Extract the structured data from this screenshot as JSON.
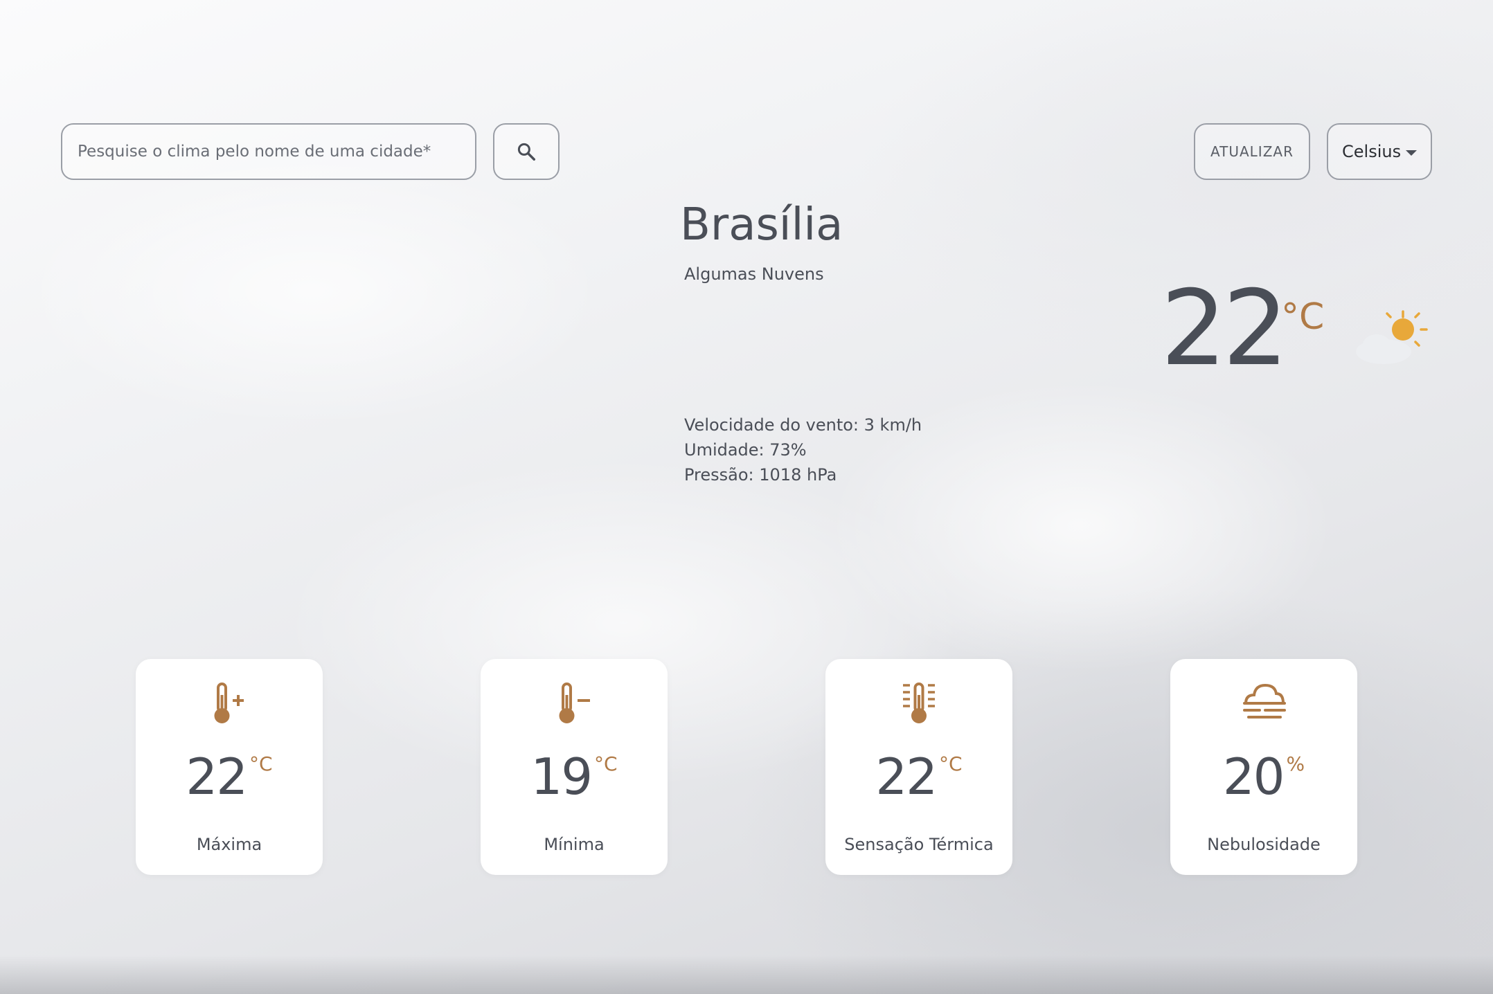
{
  "search": {
    "placeholder": "Pesquise o clima pelo nome de uma cidade*"
  },
  "toolbar": {
    "refresh_label": "ATUALIZAR",
    "unit_selected": "Celsius"
  },
  "current": {
    "city": "Brasília",
    "condition": "Algumas Nuvens",
    "temperature": "22",
    "unit": "°C",
    "icon": "sun-behind-cloud-icon"
  },
  "details": {
    "wind": "Velocidade do vento: 3 km/h",
    "humidity": "Umidade: 73%",
    "pressure": "Pressão: 1018 hPa"
  },
  "cards": [
    {
      "icon": "thermometer-plus-icon",
      "value": "22",
      "unit": "°C",
      "label": "Máxima"
    },
    {
      "icon": "thermometer-minus-icon",
      "value": "19",
      "unit": "°C",
      "label": "Mínima"
    },
    {
      "icon": "thermometer-feels-like-icon",
      "value": "22",
      "unit": "°C",
      "label": "Sensação Térmica"
    },
    {
      "icon": "fog-cloud-icon",
      "value": "20",
      "unit": "%",
      "label": "Nebulosidade"
    }
  ],
  "colors": {
    "accent": "#b07a46",
    "text": "#4a4e57",
    "sun": "#e8a83a"
  }
}
